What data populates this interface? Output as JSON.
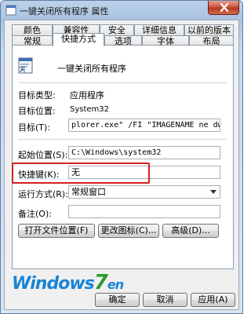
{
  "window": {
    "title": "一键关闭所有程序 属性"
  },
  "tabs_row1": [
    "颜色",
    "兼容性",
    "安全",
    "详细信息",
    "以前的版本"
  ],
  "tabs_row2": [
    "常规",
    "快捷方式",
    "选项",
    "字体",
    "布局"
  ],
  "shortcut": {
    "name": "一键关闭所有程序",
    "target_type_label": "目标类型:",
    "target_type_value": "应用程序",
    "target_location_label": "目标位置:",
    "target_location_value": "System32",
    "target_label": "目标(T):",
    "target_value": "plorer.exe\" /FI \"IMAGENAME ne dwm.exe\"&",
    "start_in_label": "起始位置(S):",
    "start_in_value": "C:\\Windows\\system32",
    "hotkey_label": "快捷键(K):",
    "hotkey_value": "无",
    "run_label": "运行方式(R):",
    "run_value": "常规窗口",
    "comment_label": "备注(O):",
    "comment_value": ""
  },
  "buttons": {
    "open_location": "打开文件位置(F)",
    "change_icon": "更改图标(C)...",
    "advanced": "高级(D)..."
  },
  "watermark": {
    "part1": "Windows",
    "part2": "7",
    "part3": "en"
  },
  "footer": {
    "ok": "确定",
    "cancel": "取消",
    "apply": "应用(A)"
  },
  "colors": {
    "highlight": "#d62020",
    "title_bar": "#a9c3e0",
    "close": "#c8503a"
  }
}
